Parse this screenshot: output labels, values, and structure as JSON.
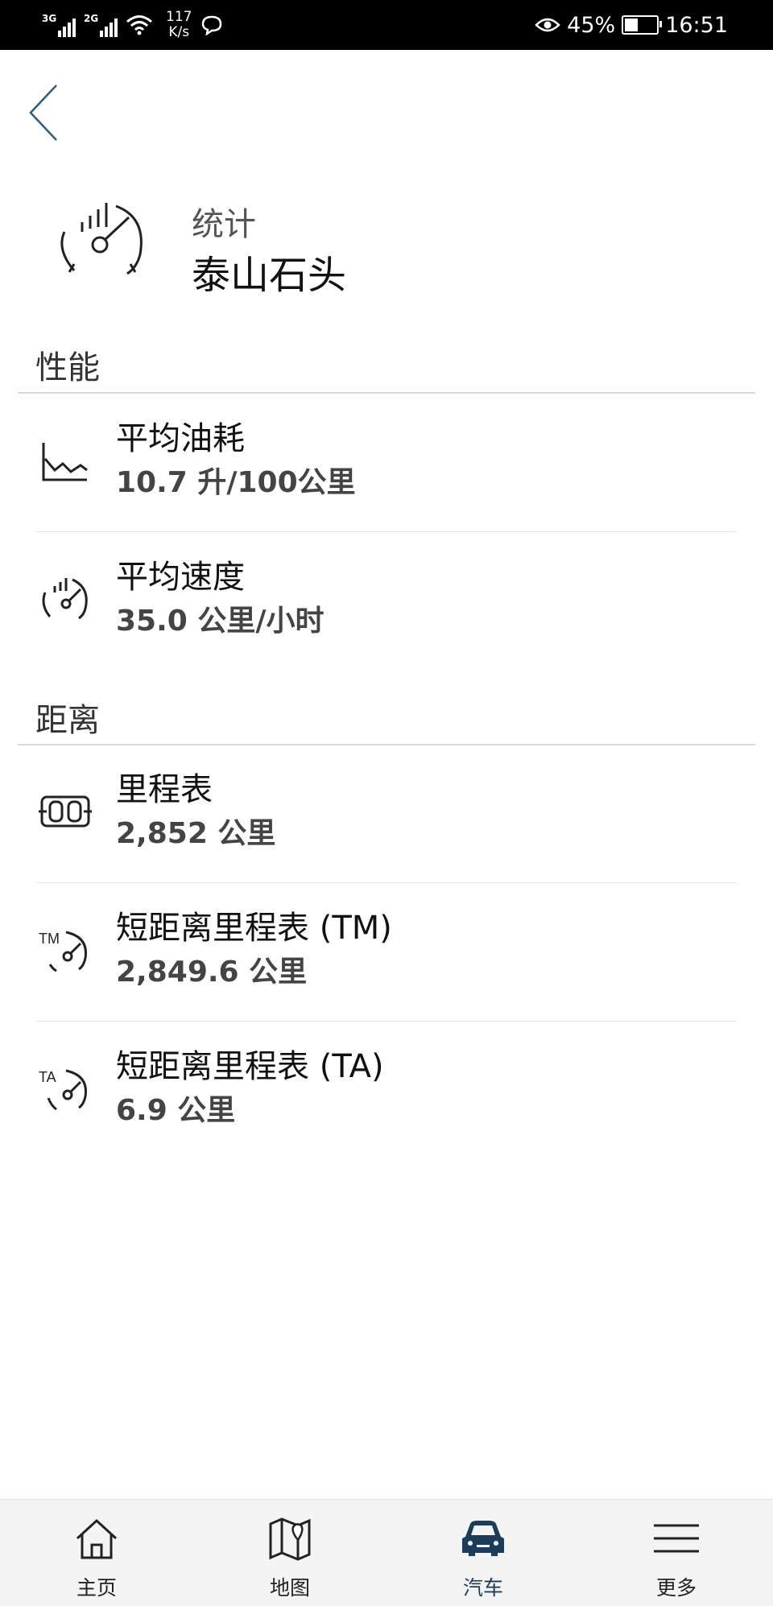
{
  "status_bar": {
    "signal1_label": "3G",
    "signal2_label": "2G",
    "net_speed_value": "117",
    "net_speed_unit": "K/s",
    "battery_percent": "45%",
    "battery_level": 0.45,
    "time": "16:51"
  },
  "header": {
    "subtitle": "统计",
    "title": "泰山石头"
  },
  "sections": {
    "performance": {
      "title": "性能",
      "items": [
        {
          "label": "平均油耗",
          "value": "10.7 升/100公里",
          "icon": "chart-icon"
        },
        {
          "label": "平均速度",
          "value": "35.0 公里/小时",
          "icon": "speedometer-icon"
        }
      ]
    },
    "distance": {
      "title": "距离",
      "items": [
        {
          "label": "里程表",
          "value": "2,852 公里",
          "icon": "odometer-icon"
        },
        {
          "label": "短距离里程表 (TM)",
          "value": "2,849.6 公里",
          "icon": "trip-meter-tm-icon"
        },
        {
          "label": "短距离里程表 (TA)",
          "value": "6.9 公里",
          "icon": "trip-meter-ta-icon"
        }
      ]
    }
  },
  "tabs": [
    {
      "label": "主页",
      "icon": "home-icon"
    },
    {
      "label": "地图",
      "icon": "map-icon"
    },
    {
      "label": "汽车",
      "icon": "car-icon",
      "active": true
    },
    {
      "label": "更多",
      "icon": "menu-icon"
    }
  ],
  "colors": {
    "accent": "#1c3d5a",
    "back_arrow": "#2a5d86"
  }
}
